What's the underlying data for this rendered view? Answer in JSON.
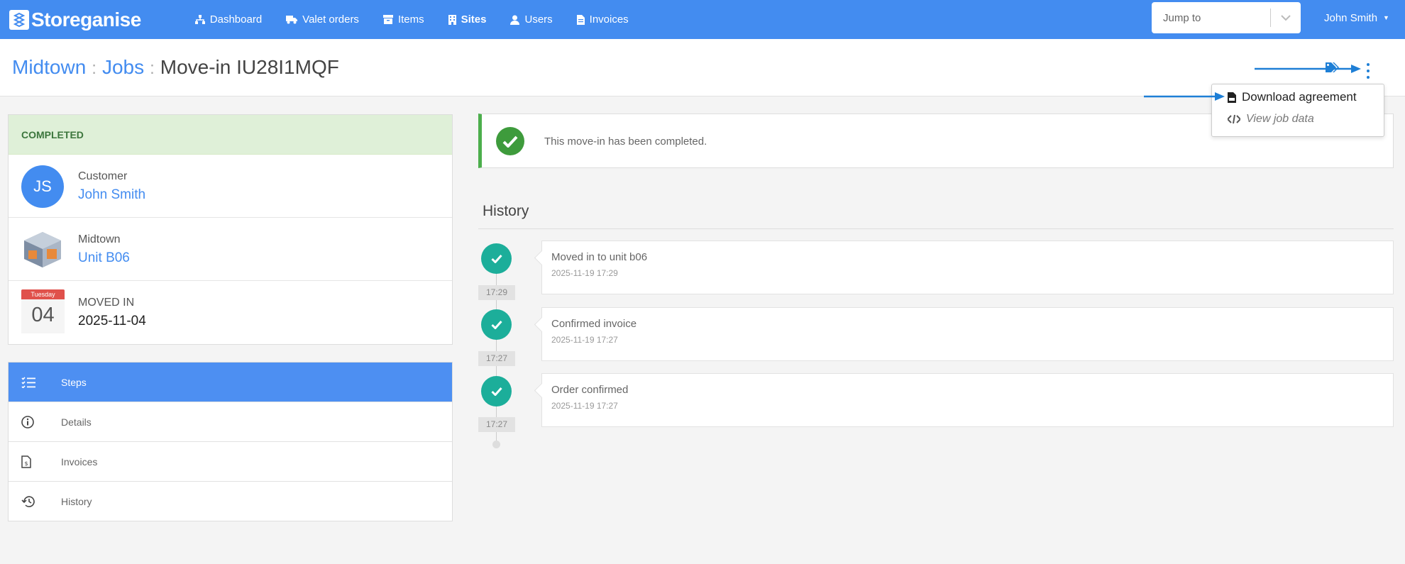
{
  "brand": {
    "name": "Storeganise"
  },
  "nav": {
    "items": [
      {
        "label": "Dashboard",
        "icon": "sitemap-icon"
      },
      {
        "label": "Valet orders",
        "icon": "truck-icon"
      },
      {
        "label": "Items",
        "icon": "archive-icon"
      },
      {
        "label": "Sites",
        "icon": "building-icon"
      },
      {
        "label": "Users",
        "icon": "user-icon"
      },
      {
        "label": "Invoices",
        "icon": "file-icon"
      }
    ],
    "jump_placeholder": "Jump to",
    "user_name": "John Smith"
  },
  "breadcrumb": {
    "site": "Midtown",
    "section": "Jobs",
    "current": "Move-in IU28I1MQF"
  },
  "dropdown": {
    "download": "Download agreement",
    "view_data": "View job data"
  },
  "status": {
    "label": "COMPLETED",
    "color": "#3c763d"
  },
  "customer": {
    "label": "Customer",
    "initials": "JS",
    "name": "John Smith"
  },
  "unit": {
    "site": "Midtown",
    "name": "Unit B06"
  },
  "moved_in": {
    "weekday": "Tuesday",
    "day": "04",
    "label": "MOVED IN",
    "date": "2025-11-04"
  },
  "side_nav": {
    "steps": "Steps",
    "details": "Details",
    "invoices": "Invoices",
    "history": "History"
  },
  "alert": {
    "text": "This move-in has been completed."
  },
  "history": {
    "title": "History",
    "events": [
      {
        "title": "Moved in to unit b06",
        "datetime": "2025-11-19 17:29",
        "time": "17:29"
      },
      {
        "title": "Confirmed invoice",
        "datetime": "2025-11-19 17:27",
        "time": "17:27"
      },
      {
        "title": "Order confirmed",
        "datetime": "2025-11-19 17:27",
        "time": "17:27"
      }
    ]
  },
  "colors": {
    "primary": "#438cf0",
    "success": "#1cae9a",
    "danger": "#e0514b"
  }
}
